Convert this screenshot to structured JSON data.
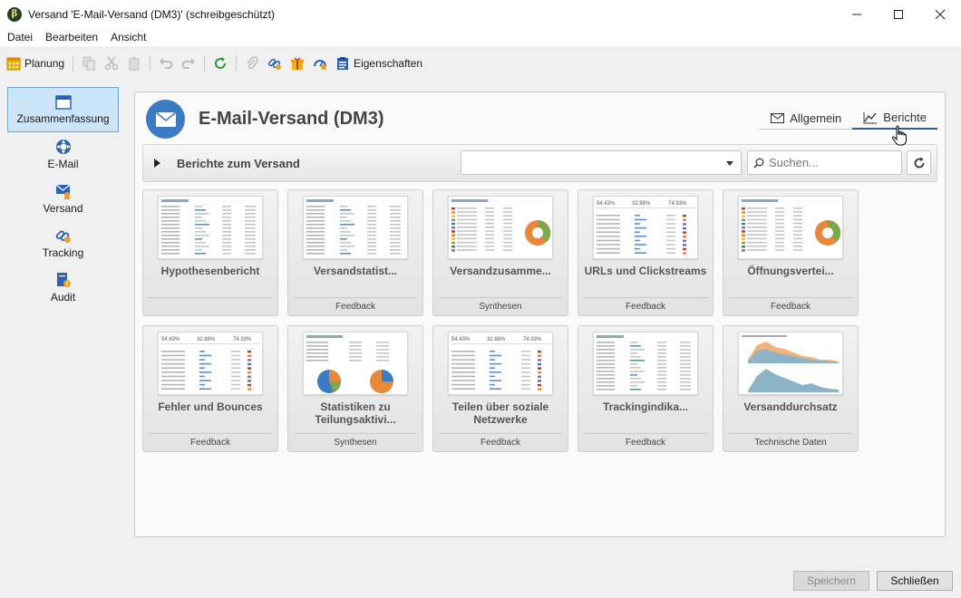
{
  "window": {
    "title": "Versand 'E-Mail-Versand (DM3)' (schreibgeschützt)",
    "app_icon_letter": "β"
  },
  "menu": [
    "Datei",
    "Bearbeiten",
    "Ansicht"
  ],
  "toolbar": {
    "planung_label": "Planung",
    "eigenschaften_label": "Eigenschaften"
  },
  "sidebar": {
    "items": [
      {
        "label": "Zusammenfassung",
        "icon": "summary-icon",
        "active": true
      },
      {
        "label": "E-Mail",
        "icon": "email-icon"
      },
      {
        "label": "Versand",
        "icon": "send-icon"
      },
      {
        "label": "Tracking",
        "icon": "tracking-icon"
      },
      {
        "label": "Audit",
        "icon": "audit-icon"
      }
    ]
  },
  "header": {
    "title": "E-Mail-Versand (DM3)",
    "tabs": [
      {
        "label": "Allgemein",
        "icon": "envelope-icon"
      },
      {
        "label": "Berichte",
        "icon": "chart-icon",
        "active": true
      }
    ]
  },
  "section": {
    "title": "Berichte zum Versand",
    "dropdown_value": "",
    "search_placeholder": "Suchen..."
  },
  "cards": [
    {
      "title": "Hypothesenbericht",
      "category": "",
      "thumb": "table"
    },
    {
      "title": "Versandstatist...",
      "category": "Feedback",
      "thumb": "table"
    },
    {
      "title": "Versandzusamme...",
      "category": "Synthesen",
      "thumb": "donut"
    },
    {
      "title": "URLs und Clickstreams",
      "category": "Feedback",
      "thumb": "stats"
    },
    {
      "title": "Öffnungsvertei...",
      "category": "Feedback",
      "thumb": "donut"
    },
    {
      "title": "Fehler und Bounces",
      "category": "Feedback",
      "thumb": "stats"
    },
    {
      "title": "Statistiken zu Teilungsaktivi...",
      "category": "Synthesen",
      "thumb": "pies"
    },
    {
      "title": "Teilen über soziale Netzwerke",
      "category": "Feedback",
      "thumb": "stats"
    },
    {
      "title": "Trackingindika...",
      "category": "Feedback",
      "thumb": "table"
    },
    {
      "title": "Versanddurchsatz",
      "category": "Technische Daten",
      "thumb": "area"
    }
  ],
  "footer": {
    "save_label": "Speichern",
    "close_label": "Schließen"
  },
  "colors": {
    "accent_blue": "#3b7bc4",
    "sidebar_active": "#cce4f7",
    "donut_orange": "#e8883a",
    "donut_green": "#7fa84a"
  }
}
